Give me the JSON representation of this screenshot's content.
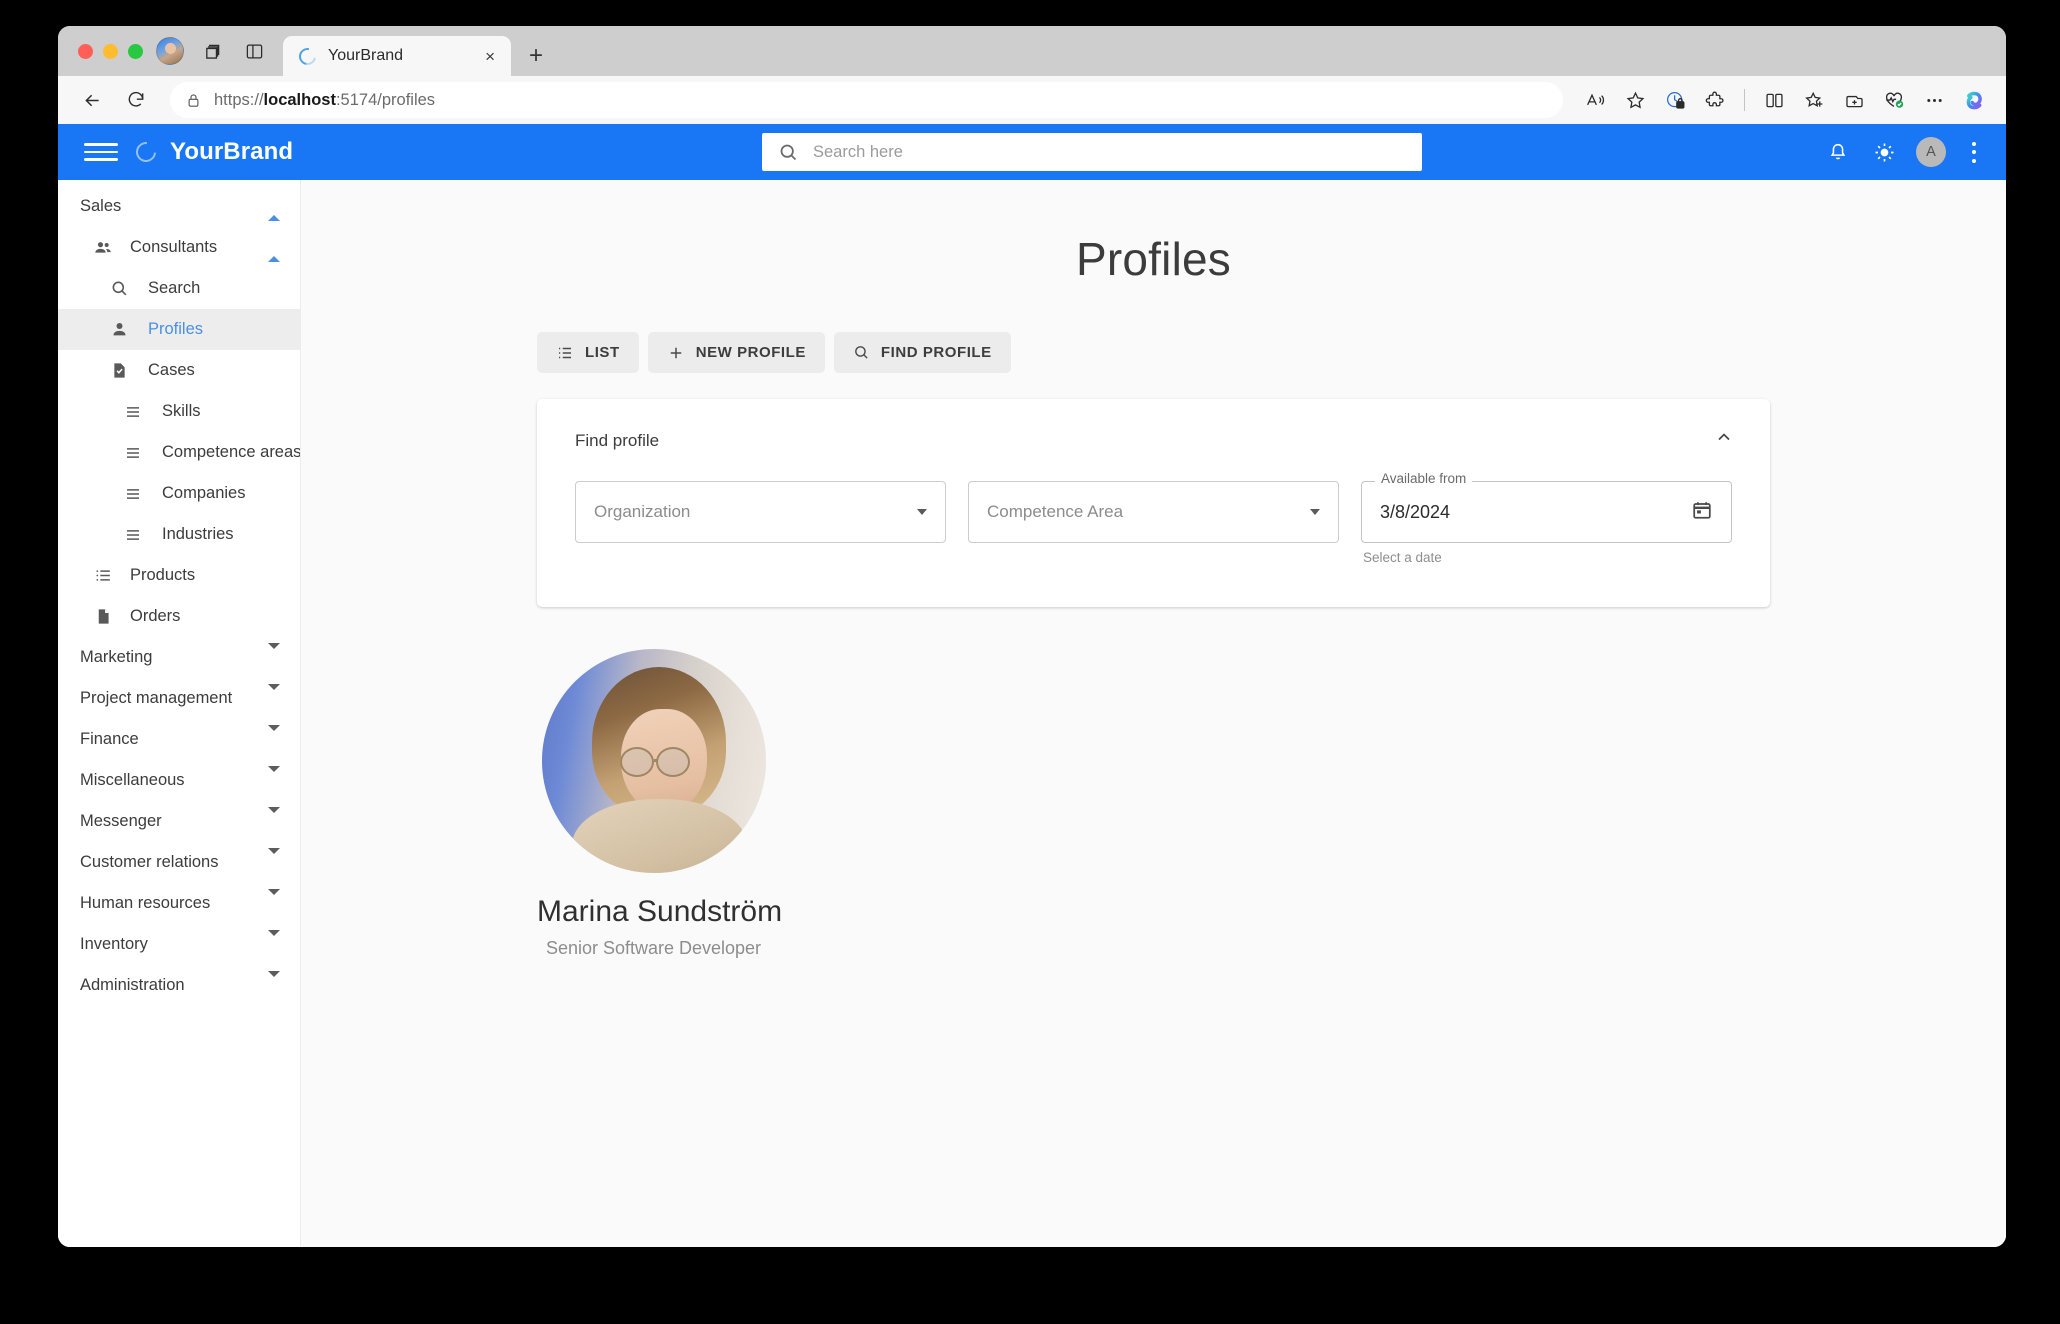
{
  "browser": {
    "tab": {
      "title": "YourBrand",
      "favicon": "loading-ring-icon",
      "close_label": "×"
    },
    "new_tab_label": "+",
    "url": {
      "scheme": "https://",
      "host": "localhost",
      "rest": ":5174/profiles",
      "full": "https://localhost:5174/profiles"
    },
    "toolbar_icons": [
      "read-aloud-icon",
      "favorite-star-icon",
      "tracking-prevention-icon",
      "extensions-icon",
      "split-screen-icon",
      "add-favorite-icon",
      "collections-icon",
      "browser-essentials-icon",
      "settings-more-icon",
      "copilot-icon"
    ],
    "nav_icons": [
      "back-icon",
      "reload-icon",
      "site-info-lock-icon"
    ],
    "tabstrip_icons": [
      "profile-avatar-icon",
      "workspaces-icon",
      "tab-actions-icon"
    ]
  },
  "appbar": {
    "brand": "YourBrand",
    "menu_icon": "hamburger-menu-icon",
    "logo_icon": "brand-ring-icon",
    "search_placeholder": "Search here",
    "search_value": "",
    "search_icon": "search-icon",
    "notifications_icon": "notification-bell-icon",
    "theme_icon": "sun-light-mode-icon",
    "avatar_initial": "A",
    "overflow_icon": "more-vertical-icon",
    "accent_color": "#1976f5"
  },
  "sidebar": {
    "items": [
      {
        "label": "Sales",
        "level": 0,
        "icon": null,
        "caret": "up",
        "active": false
      },
      {
        "label": "Consultants",
        "level": 1,
        "icon": "people-icon",
        "caret": "up",
        "active": false
      },
      {
        "label": "Search",
        "level": 2,
        "icon": "search-icon",
        "caret": null,
        "active": false
      },
      {
        "label": "Profiles",
        "level": 2,
        "icon": "person-icon",
        "caret": null,
        "active": true
      },
      {
        "label": "Cases",
        "level": 2,
        "icon": "case-document-icon",
        "caret": null,
        "active": false
      },
      {
        "label": "Skills",
        "level": 3,
        "icon": "list-icon",
        "caret": null,
        "active": false
      },
      {
        "label": "Competence areas",
        "level": 3,
        "icon": "list-icon",
        "caret": null,
        "active": false
      },
      {
        "label": "Companies",
        "level": 3,
        "icon": "list-icon",
        "caret": null,
        "active": false
      },
      {
        "label": "Industries",
        "level": 3,
        "icon": "list-icon",
        "caret": null,
        "active": false
      },
      {
        "label": "Products",
        "level": 1,
        "icon": "list-bullet-icon",
        "caret": null,
        "active": false
      },
      {
        "label": "Orders",
        "level": 1,
        "icon": "document-icon",
        "caret": null,
        "active": false
      },
      {
        "label": "Marketing",
        "level": 0,
        "icon": null,
        "caret": "down",
        "active": false
      },
      {
        "label": "Project management",
        "level": 0,
        "icon": null,
        "caret": "down",
        "active": false
      },
      {
        "label": "Finance",
        "level": 0,
        "icon": null,
        "caret": "down",
        "active": false
      },
      {
        "label": "Miscellaneous",
        "level": 0,
        "icon": null,
        "caret": "down",
        "active": false
      },
      {
        "label": "Messenger",
        "level": 0,
        "icon": null,
        "caret": "down",
        "active": false
      },
      {
        "label": "Customer relations",
        "level": 0,
        "icon": null,
        "caret": "down",
        "active": false
      },
      {
        "label": "Human resources",
        "level": 0,
        "icon": null,
        "caret": "down",
        "active": false
      },
      {
        "label": "Inventory",
        "level": 0,
        "icon": null,
        "caret": "down",
        "active": false
      },
      {
        "label": "Administration",
        "level": 0,
        "icon": null,
        "caret": "down",
        "active": false
      }
    ]
  },
  "main": {
    "page_title": "Profiles",
    "toolbar": [
      {
        "label": "LIST",
        "icon": "list-icon"
      },
      {
        "label": "NEW PROFILE",
        "icon": "plus-icon"
      },
      {
        "label": "FIND PROFILE",
        "icon": "search-icon"
      }
    ],
    "find_profile": {
      "heading": "Find profile",
      "collapse_icon": "chevron-up-icon",
      "organization": {
        "placeholder": "Organization",
        "value": ""
      },
      "competence_area": {
        "placeholder": "Competence Area",
        "value": ""
      },
      "available_from": {
        "label": "Available from",
        "value": "3/8/2024",
        "helper": "Select a date",
        "icon": "calendar-icon"
      }
    },
    "result": {
      "name": "Marina Sundström",
      "role": "Senior Software Developer",
      "avatar": "profile-photo"
    }
  }
}
